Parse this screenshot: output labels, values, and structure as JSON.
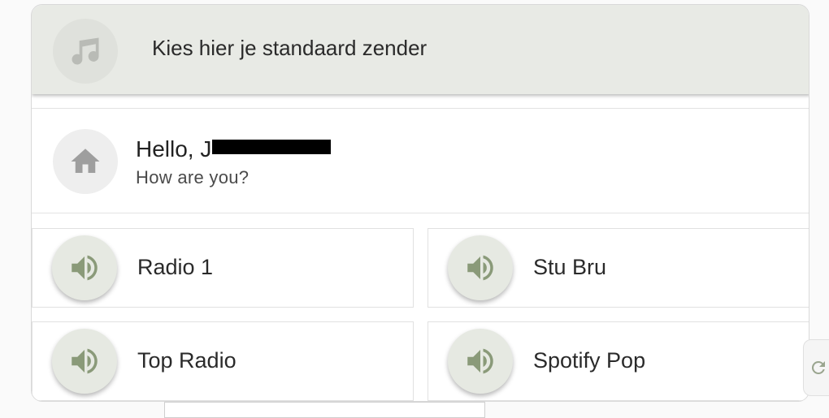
{
  "header": {
    "title": "Kies hier je standaard zender",
    "icon": "music-note-icon"
  },
  "greeting": {
    "title": "Hello, J",
    "subtitle": "How are you?",
    "icon": "home-icon"
  },
  "stations": [
    {
      "label": "Radio 1",
      "icon": "speaker-icon"
    },
    {
      "label": "Stu Bru",
      "icon": "speaker-icon"
    },
    {
      "label": "Top Radio",
      "icon": "speaker-icon"
    },
    {
      "label": "Spotify Pop",
      "icon": "speaker-icon"
    }
  ],
  "colors": {
    "accent": "#8a9a79",
    "header_bg": "#e8eae5",
    "icon_grey": "#a3a3a3"
  }
}
